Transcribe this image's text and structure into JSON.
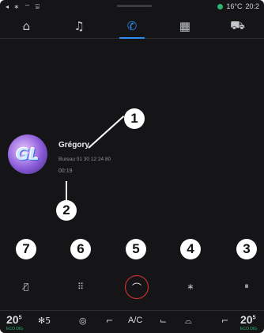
{
  "status_bar": {
    "left_icons": "◂ ∗ ⌔ ⌸",
    "outside_temp": "16°C",
    "time": "20:2",
    "connection_color": "#2bb673"
  },
  "tabs": [
    {
      "name": "home",
      "icon": "⌂"
    },
    {
      "name": "music",
      "icon": "♫"
    },
    {
      "name": "phone",
      "icon": "✆"
    },
    {
      "name": "apps",
      "icon": "▦"
    },
    {
      "name": "vehicle",
      "icon": "⛟"
    }
  ],
  "contact": {
    "avatar_initials": "GL",
    "name": "Grégory",
    "number": "Bureau 01 30 12 24 80",
    "duration": "00:19"
  },
  "callouts": [
    "1",
    "2",
    "3",
    "4",
    "5",
    "6",
    "7"
  ],
  "call_buttons": {
    "mute_icon": "🎙̸",
    "keypad_icon": "⠿",
    "hangup_icon": "⌒",
    "bluetooth_icon": "∗",
    "hold_icon": "⏸",
    "hangup_color": "#e03434"
  },
  "climate": {
    "left_temp": "20",
    "left_temp_decimal": "5",
    "left_eco": "ECO DIG",
    "fan_icon": "✻",
    "fan_level": "5",
    "steering_heat_icon": "◎",
    "seat_heat_icon": "⌐",
    "ac_label": "A/C",
    "seat_icon": "⌙",
    "defrost_icon": "⌓",
    "seat_right_icon": "⌐",
    "right_temp": "20",
    "right_temp_decimal": "5",
    "right_eco": "ECO DIG"
  }
}
